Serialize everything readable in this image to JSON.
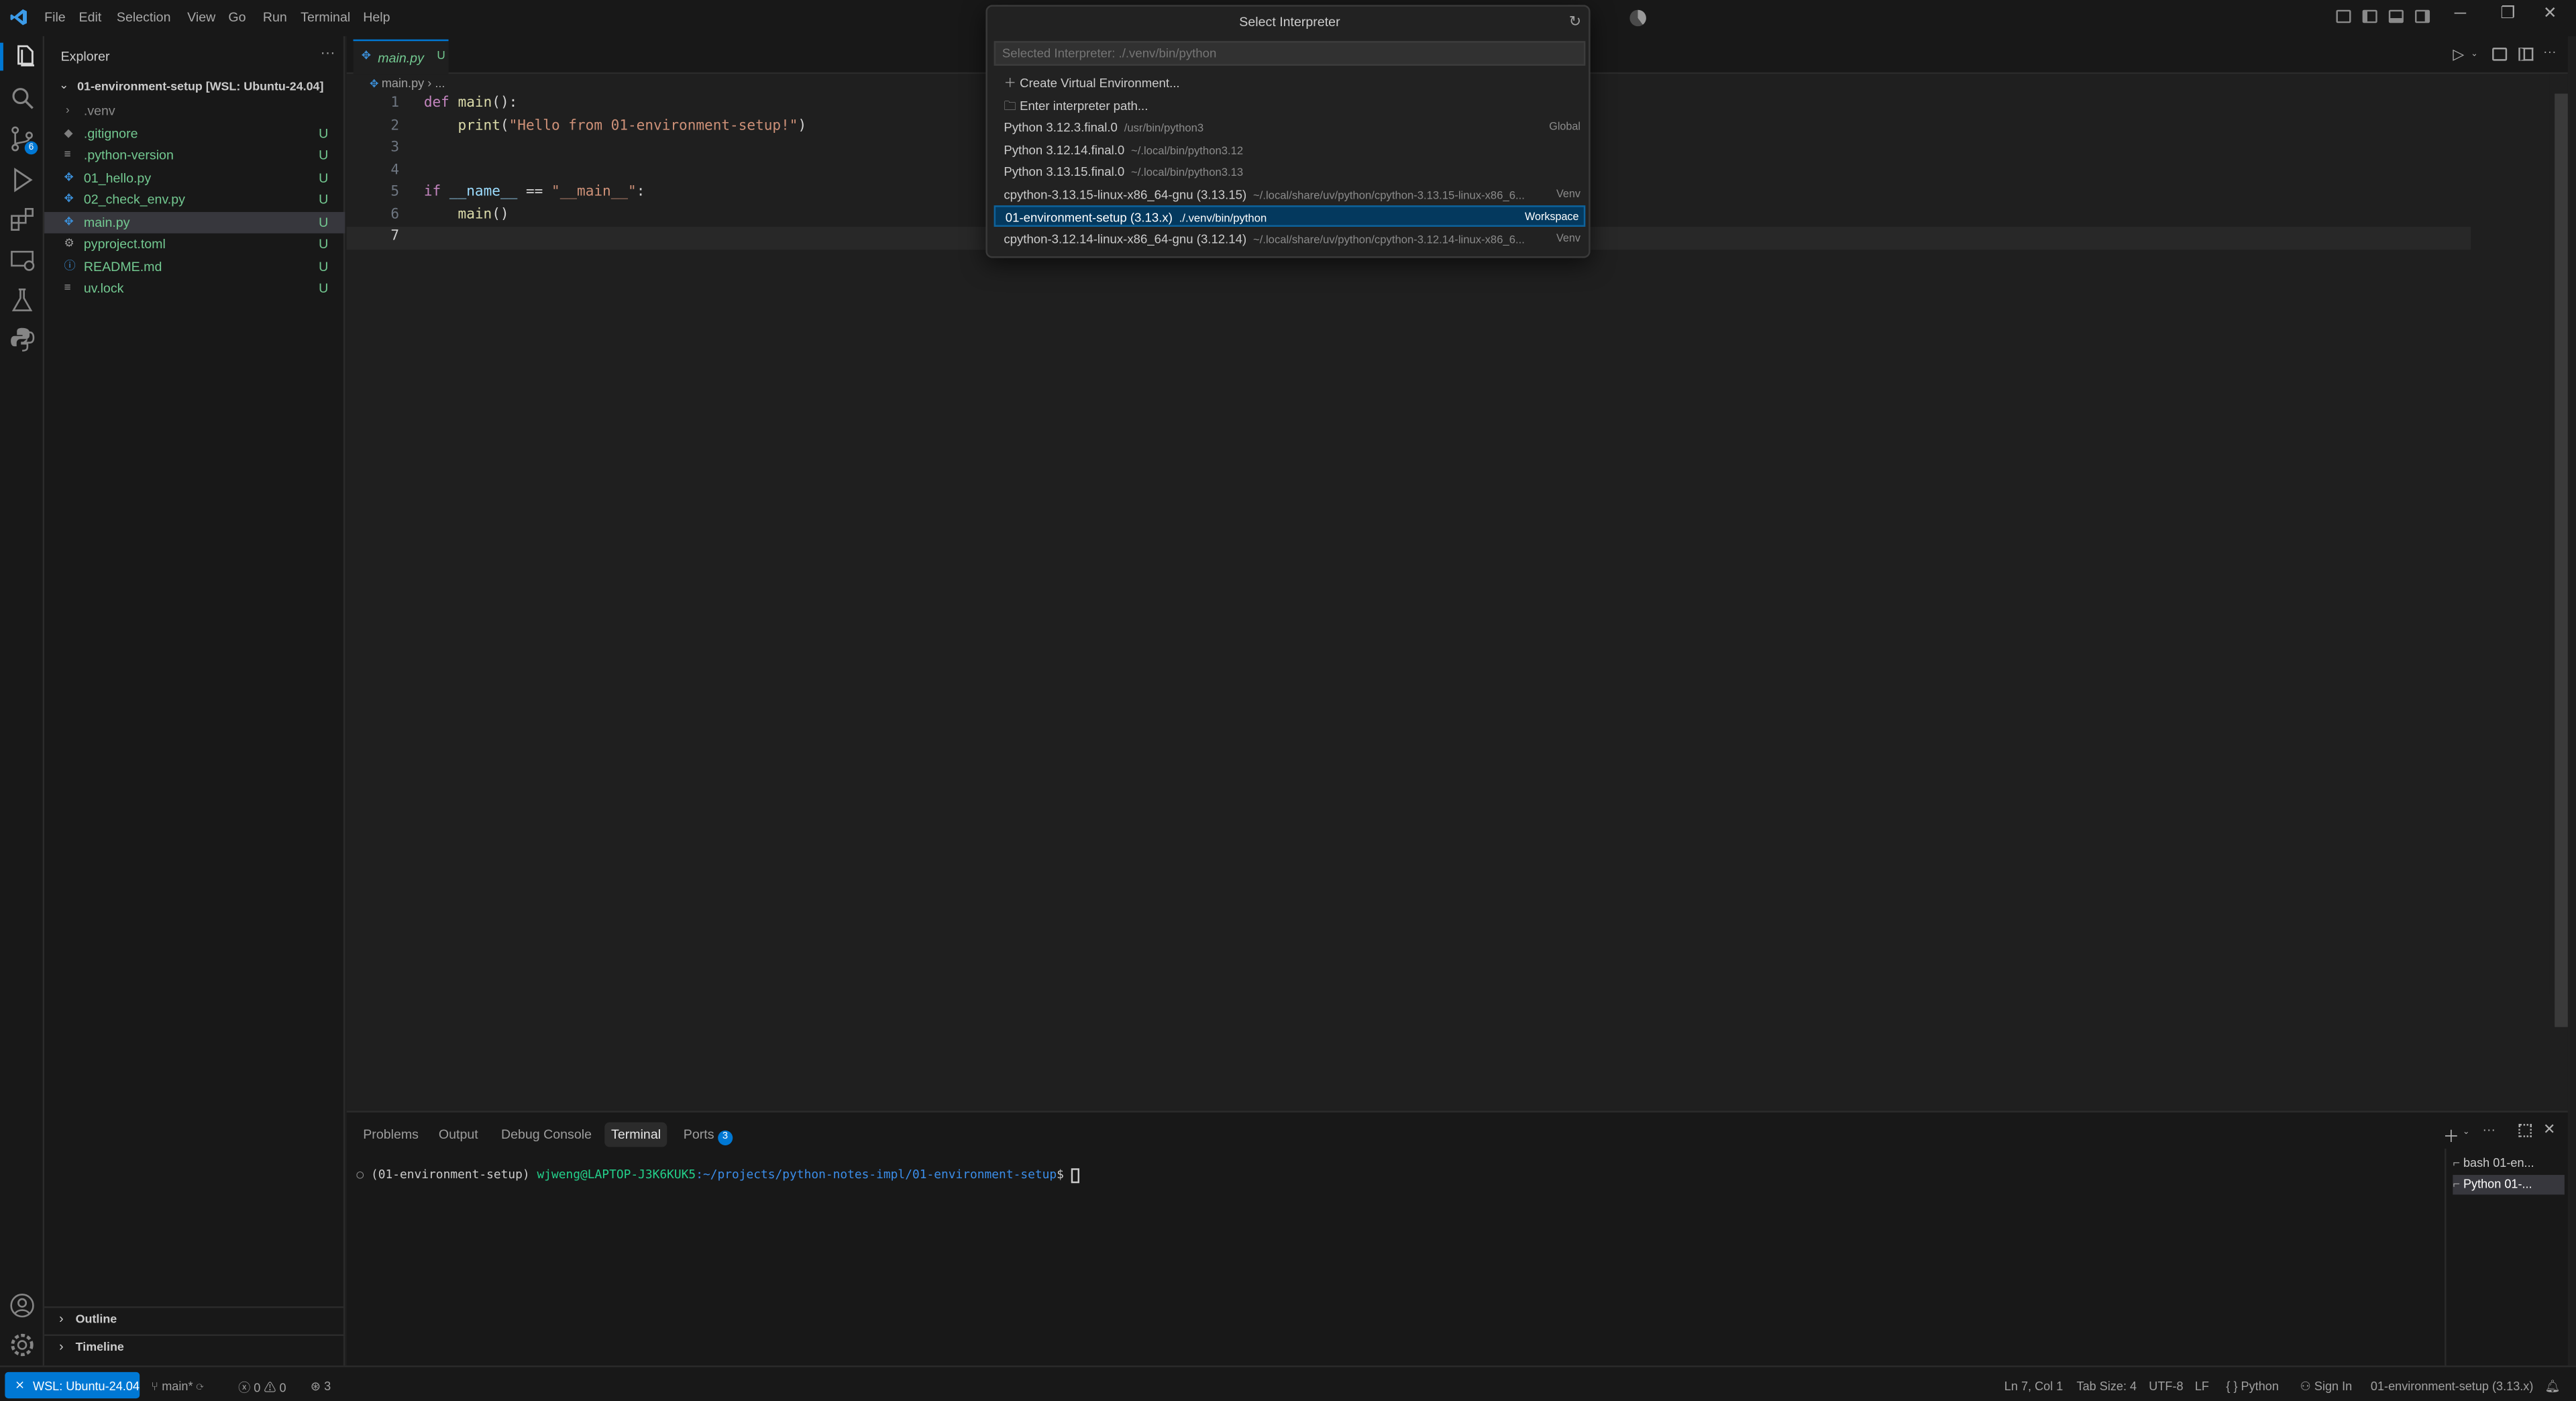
{
  "title_bar": {
    "menu": [
      "File",
      "Edit",
      "Selection",
      "View",
      "Go",
      "Run",
      "Terminal",
      "Help"
    ]
  },
  "quick_pick": {
    "title": "Select Interpreter",
    "placeholder": "Selected Interpreter: ./.venv/bin/python",
    "items": [
      {
        "label": "Create Virtual Environment...",
        "desc": "",
        "tag": ""
      },
      {
        "label": "Enter interpreter path...",
        "desc": "",
        "tag": ""
      },
      {
        "label": "Python 3.12.3.final.0",
        "desc": "/usr/bin/python3",
        "tag": "Global"
      },
      {
        "label": "Python 3.12.14.final.0",
        "desc": "~/.local/bin/python3.12",
        "tag": ""
      },
      {
        "label": "Python 3.13.15.final.0",
        "desc": "~/.local/bin/python3.13",
        "tag": ""
      },
      {
        "label": "cpython-3.13.15-linux-x86_64-gnu (3.13.15)",
        "desc": "~/.local/share/uv/python/cpython-3.13.15-linux-x86_6...",
        "tag": "Venv"
      },
      {
        "label": "01-environment-setup (3.13.x)",
        "desc": "./.venv/bin/python",
        "tag": "Workspace"
      },
      {
        "label": "cpython-3.12.14-linux-x86_64-gnu (3.12.14)",
        "desc": "~/.local/share/uv/python/cpython-3.12.14-linux-x86_6...",
        "tag": "Venv"
      }
    ]
  },
  "sidebar": {
    "title": "Explorer",
    "root": "01-environment-setup [WSL: Ubuntu-24.04]",
    "files": [
      {
        "name": ".venv",
        "status": ""
      },
      {
        "name": ".gitignore",
        "status": "U"
      },
      {
        "name": ".python-version",
        "status": "U"
      },
      {
        "name": "01_hello.py",
        "status": "U"
      },
      {
        "name": "02_check_env.py",
        "status": "U"
      },
      {
        "name": "main.py",
        "status": "U"
      },
      {
        "name": "pyproject.toml",
        "status": "U"
      },
      {
        "name": "README.md",
        "status": "U"
      },
      {
        "name": "uv.lock",
        "status": "U"
      }
    ],
    "outline": "Outline",
    "timeline": "Timeline"
  },
  "editor": {
    "tab": {
      "name": "main.py",
      "status": "U"
    },
    "breadcrumb": [
      "main.py",
      "..."
    ],
    "line_numbers": [
      "1",
      "2",
      "3",
      "4",
      "5",
      "6",
      "7"
    ],
    "code": [
      {
        "kw": "def",
        "rest_fn": "main",
        "rest": "():"
      },
      {
        "fn": "print",
        "str": "\"Hello from 01-environment-setup!\""
      },
      {},
      {},
      {
        "kw": "if",
        "var": "__name__",
        "op": " == ",
        "str": "\"__main__\"",
        "tail": ":"
      },
      {
        "fn": "main",
        "tail": "()"
      },
      {}
    ]
  },
  "panel": {
    "tabs": [
      "Problems",
      "Output",
      "Debug Console",
      "Terminal",
      "Ports"
    ],
    "ports_badge": "3",
    "terminal": {
      "env": "(01-environment-setup)",
      "user_host": "wjweng@LAPTOP-J3K6KUK5",
      "path": ":~/projects/python-notes-impl/01-environment-setup",
      "prompt": "$"
    },
    "terminal_list": [
      "bash 01-en...",
      "Python 01-..."
    ]
  },
  "status_bar": {
    "remote": "WSL: Ubuntu-24.04",
    "branch": "main*",
    "errors": "0",
    "warnings": "0",
    "ports": "3",
    "position": "Ln 7, Col 1",
    "tab_size": "Tab Size: 4",
    "encoding": "UTF-8",
    "eol": "LF",
    "language": "Python",
    "sign_in": "Sign In",
    "interpreter": "01-environment-setup (3.13.x)"
  },
  "colors": {
    "accent": "#0078d4",
    "untracked": "#73c991",
    "selection": "#04395e"
  }
}
